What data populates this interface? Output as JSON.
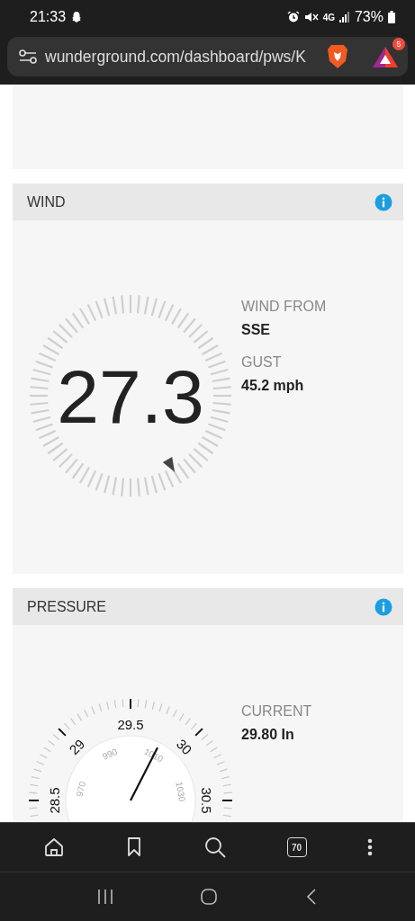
{
  "status_bar": {
    "time": "21:33",
    "network": "4G",
    "battery": "73%"
  },
  "address_bar": {
    "url": "wunderground.com/dashboard/pws/K",
    "rewards_badge": "5"
  },
  "wind": {
    "title": "WIND",
    "speed": "27.3",
    "stats": [
      {
        "label": "WIND FROM",
        "value": "SSE"
      },
      {
        "label": "GUST",
        "value": "45.2 mph"
      }
    ]
  },
  "pressure": {
    "title": "PRESSURE",
    "outer_labels": [
      "28.5",
      "29",
      "29.5",
      "30",
      "30.5"
    ],
    "inner_labels": [
      "970",
      "990",
      "1010",
      "1030"
    ],
    "stats": [
      {
        "label": "CURRENT",
        "value": "29.80 In"
      }
    ]
  },
  "bottom_toolbar": {
    "tab_count": "70"
  }
}
